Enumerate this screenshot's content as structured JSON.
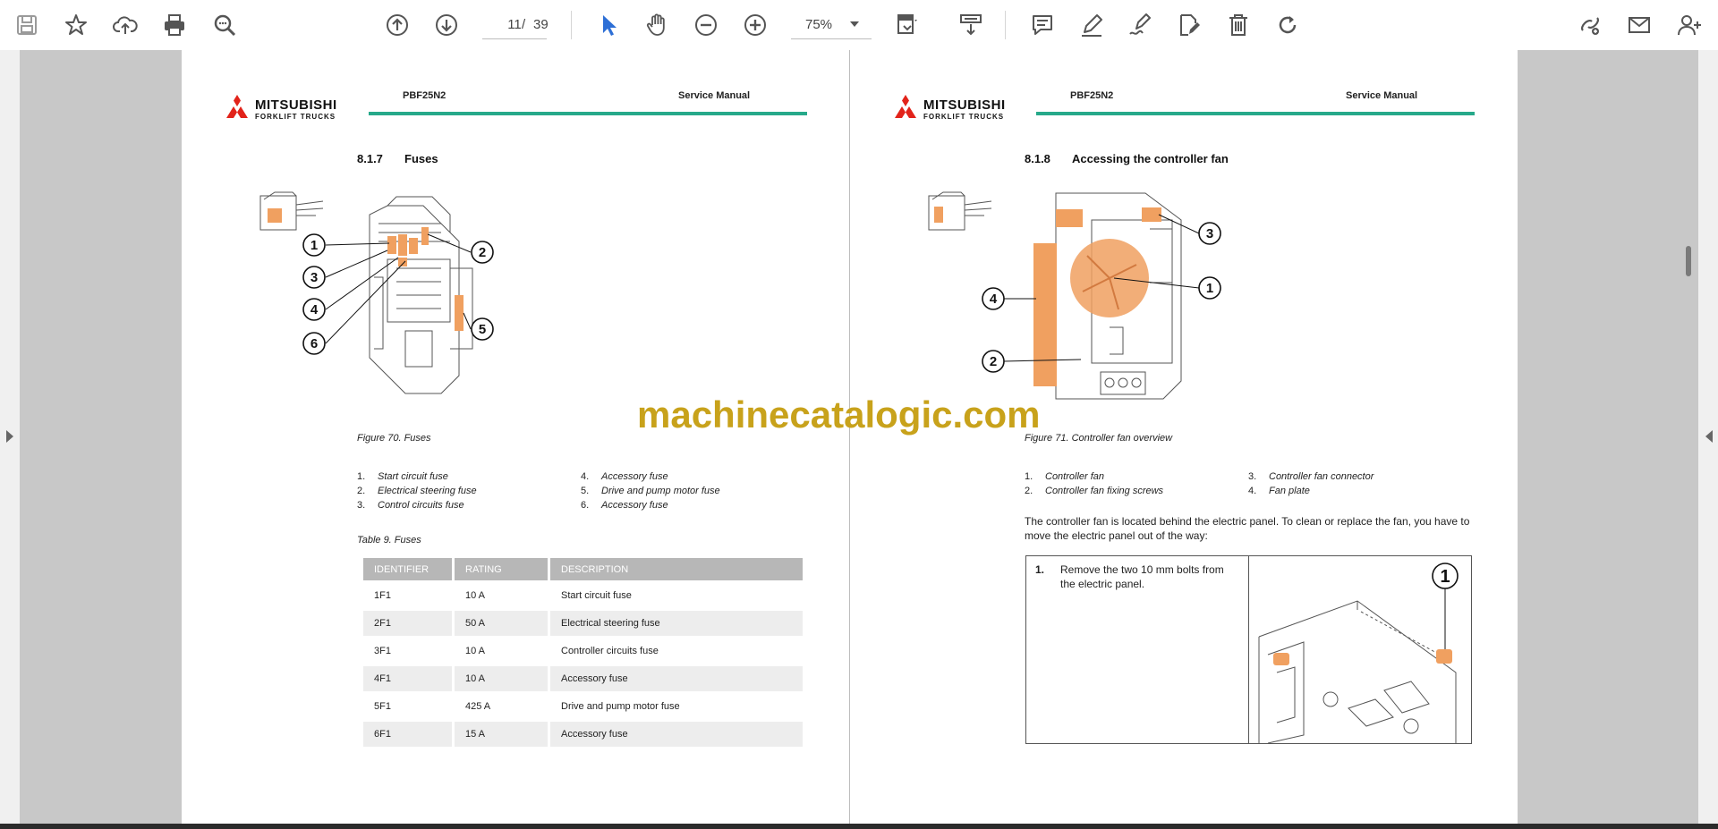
{
  "toolbar": {
    "page_current": "11",
    "page_separator": "/",
    "page_total": "39",
    "zoom": "75%",
    "icons": [
      "save-icon",
      "bookmark-star-icon",
      "upload-cloud-icon",
      "print-icon",
      "zoom-search-icon",
      "page-up-icon",
      "page-down-icon",
      "select-cursor-icon",
      "hand-pan-icon",
      "zoom-out-icon",
      "zoom-in-icon",
      "fit-page-icon",
      "rotate-view-icon",
      "comment-icon",
      "highlight-pen-icon",
      "signature-icon",
      "edit-document-icon",
      "delete-icon",
      "redo-icon",
      "share-link-icon",
      "email-icon",
      "add-user-icon"
    ]
  },
  "colors": {
    "accent_blue": "#2d6fd6",
    "header_line": "#26a98a",
    "logo_red": "#e2231a",
    "callout_orange": "#f0a060",
    "watermark": "#c8a21b"
  },
  "header": {
    "brand": "MITSUBISHI",
    "brand_sub": "FORKLIFT TRUCKS",
    "model": "PBF25N2",
    "manual": "Service Manual"
  },
  "left_page": {
    "section_number": "8.1.7",
    "section_title": "Fuses",
    "callouts": [
      "1",
      "2",
      "3",
      "4",
      "5",
      "6"
    ],
    "figure_caption": "Figure 70. Fuses",
    "legend_col1": [
      {
        "num": "1.",
        "text": "Start circuit fuse"
      },
      {
        "num": "2.",
        "text": "Electrical steering fuse"
      },
      {
        "num": "3.",
        "text": "Control circuits fuse"
      }
    ],
    "legend_col2": [
      {
        "num": "4.",
        "text": "Accessory fuse"
      },
      {
        "num": "5.",
        "text": "Drive and pump motor fuse"
      },
      {
        "num": "6.",
        "text": "Accessory fuse"
      }
    ],
    "table_caption": "Table 9. Fuses",
    "table": {
      "headers": [
        "IDENTIFIER",
        "RATING",
        "DESCRIPTION"
      ],
      "rows": [
        [
          "1F1",
          "10 A",
          "Start circuit fuse"
        ],
        [
          "2F1",
          "50 A",
          "Electrical steering fuse"
        ],
        [
          "3F1",
          "10 A",
          "Controller circuits fuse"
        ],
        [
          "4F1",
          "10 A",
          "Accessory fuse"
        ],
        [
          "5F1",
          "425 A",
          "Drive and pump motor fuse"
        ],
        [
          "6F1",
          "15 A",
          "Accessory fuse"
        ]
      ]
    }
  },
  "right_page": {
    "section_number": "8.1.8",
    "section_title": "Accessing the controller fan",
    "callouts": [
      "1",
      "2",
      "3",
      "4"
    ],
    "figure_caption": "Figure 71. Controller fan overview",
    "legend_col1": [
      {
        "num": "1.",
        "text": "Controller fan"
      },
      {
        "num": "2.",
        "text": "Controller fan fixing screws"
      }
    ],
    "legend_col2": [
      {
        "num": "3.",
        "text": "Controller fan connector"
      },
      {
        "num": "4.",
        "text": "Fan plate"
      }
    ],
    "body_text": "The controller fan is located behind the electric panel. To clean or replace the fan, you have to move the electric panel out of the way:",
    "step_number": "1.",
    "step_text": "Remove the two 10 mm bolts from the electric panel.",
    "step_callout": "1"
  },
  "watermark": "machinecatalogic.com"
}
